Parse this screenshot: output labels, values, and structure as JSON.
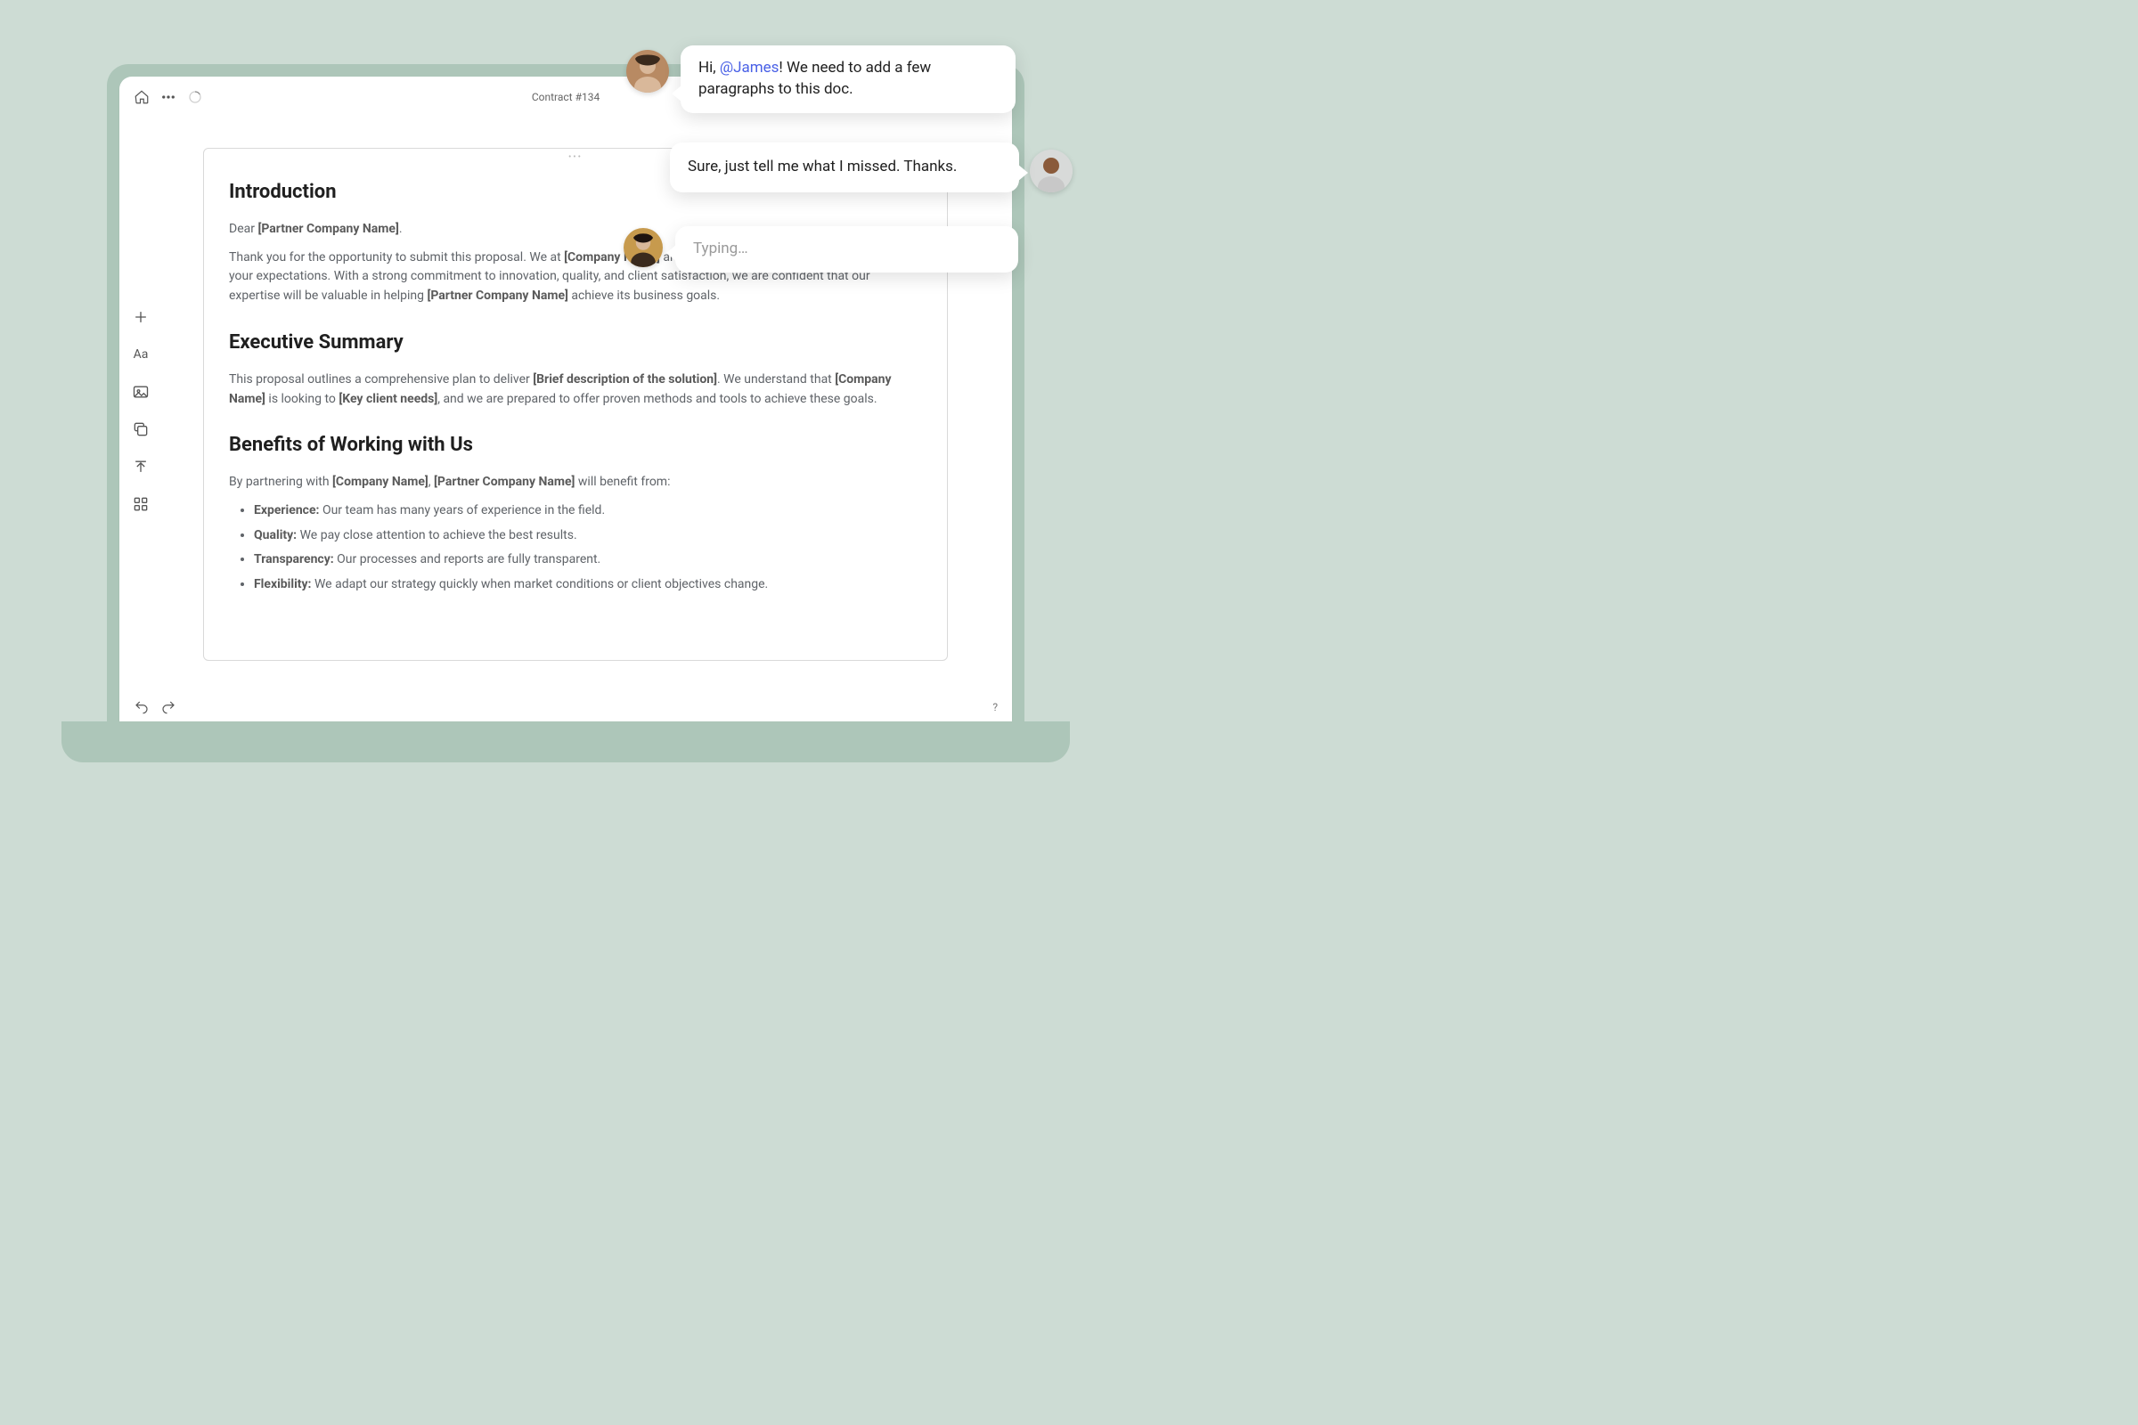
{
  "header": {
    "doc_title": "Contract #134"
  },
  "document": {
    "h_intro": "Introduction",
    "intro_salutation_pre": "Dear ",
    "intro_salutation_ph": "[Partner Company Name]",
    "intro_salutation_post": ".",
    "intro_p_1a": "Thank you for the opportunity to submit this proposal. We at ",
    "intro_p_company": "[Company Name]",
    "intro_p_1b": " are excited to meet your needs and exceed your expectations. With a strong commitment to innovation, quality, and client satisfaction, we are confident that our expertise will be valuable in helping ",
    "intro_p_partner": "[Partner Company Name]",
    "intro_p_1c": " achieve its business goals.",
    "h_exec": "Executive Summary",
    "exec_a": "This proposal outlines a comprehensive plan to deliver ",
    "exec_brief": "[Brief description of the solution]",
    "exec_b": ". We understand that ",
    "exec_company": "[Company Name]",
    "exec_c": " is looking to ",
    "exec_needs": "[Key client needs]",
    "exec_d": ", and we are prepared to offer proven methods and tools to achieve these goals.",
    "h_benefits": "Benefits of Working with Us",
    "ben_intro_a": "By partnering with ",
    "ben_company": "[Company Name]",
    "ben_intro_b": ", ",
    "ben_partner": "[Partner Company Name]",
    "ben_intro_c": " will benefit from:",
    "bullets": [
      {
        "k": "Experience:",
        "v": " Our team has many years of experience in the field."
      },
      {
        "k": "Quality:",
        "v": " We pay close attention to achieve the best results."
      },
      {
        "k": "Transparency:",
        "v": " Our processes and reports are fully transparent."
      },
      {
        "k": "Flexibility:",
        "v": " We adapt our strategy quickly when market conditions or client objectives change."
      }
    ]
  },
  "chat": {
    "msg1_pre": "Hi, ",
    "msg1_mention": "@James",
    "msg1_post": "! We need to add a few paragraphs to this doc.",
    "msg2": "Sure, just tell me what I missed. Thanks.",
    "msg3": "Typing…"
  },
  "bottom": {
    "help": "?"
  }
}
